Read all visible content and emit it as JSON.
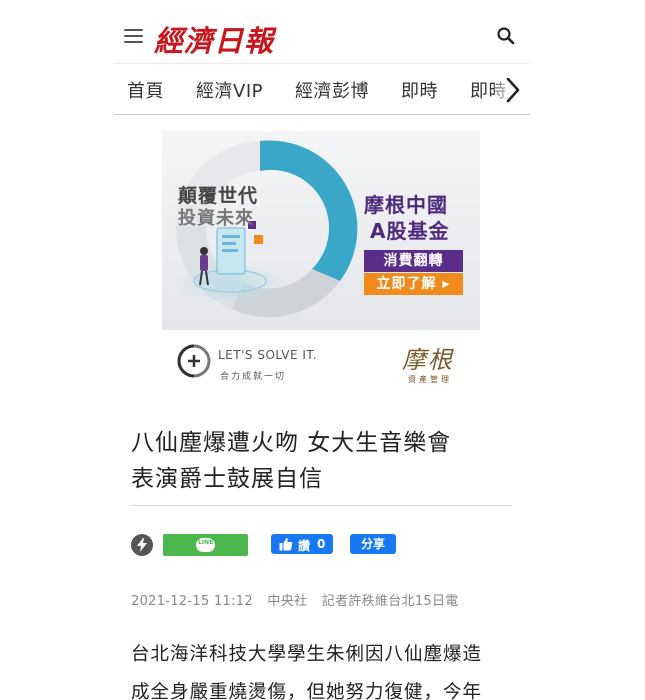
{
  "header": {
    "logo": "經濟日報",
    "menu_icon": "hamburger-menu-icon",
    "search_icon": "search-icon"
  },
  "nav": {
    "items": [
      "首頁",
      "經濟VIP",
      "經濟彭博",
      "即時",
      "即時"
    ],
    "next_icon": "chevron-right-icon"
  },
  "ad": {
    "left_line1": "顛覆世代",
    "left_line2": "投資未來",
    "right_title1": "摩根中國",
    "right_title2": "A股基金",
    "tag1": "消費翻轉",
    "tag2": "立即了解 ▸",
    "slogan": "LET'S SOLVE IT.",
    "slogan_sub": "合力成就一切",
    "brand": "摩根",
    "brand_sub": "資產管理",
    "colors": {
      "purple": "#5a2d88",
      "orange": "#f08a1c",
      "teal": "#3aa7c9"
    }
  },
  "article": {
    "headline_line1": "八仙塵爆遭火吻 女大生音樂會",
    "headline_line2": "表演爵士鼓展自信",
    "date": "2021-12-15 11:12",
    "source": "中央社",
    "reporter": "記者許秩維台北15日電",
    "body_line1": "台北海洋科技大學學生朱俐因八仙塵爆造",
    "body_line2": "成全身嚴重燒燙傷，但她努力復健，今年"
  },
  "share": {
    "line_label": "LINE",
    "fb_label": "讚",
    "fb_count": "0",
    "share_label": "分享",
    "colors": {
      "line": "#4cb74c",
      "facebook": "#1877f2"
    }
  }
}
